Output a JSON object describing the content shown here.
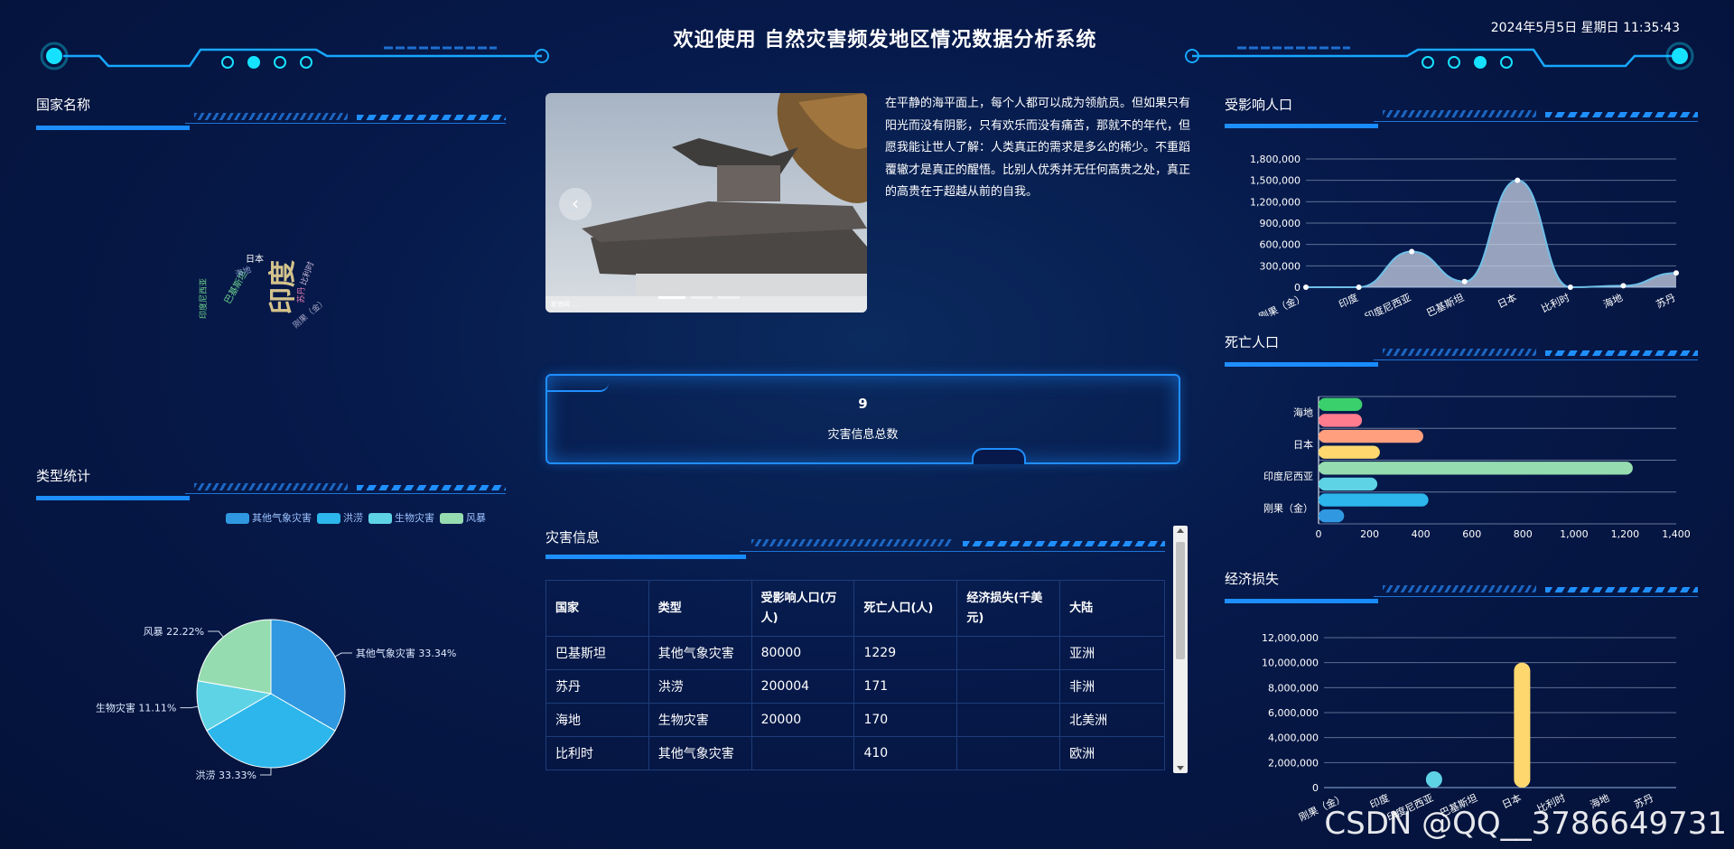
{
  "header": {
    "title": "欢迎使用 自然灾害频发地区情况数据分析系统",
    "datetime": "2024年5月5日 星期日 11:35:43"
  },
  "panels": {
    "country_names": "国家名称",
    "type_stats": "类型统计",
    "affected": "受影响人口",
    "deaths": "死亡人口",
    "economic": "经济损失",
    "disaster_info": "灾害信息"
  },
  "wordcloud": [
    {
      "text": "印度",
      "color": "#d4c38c"
    },
    {
      "text": "巴基斯坦",
      "color": "#6bd08c"
    },
    {
      "text": "日本",
      "color": "#ffffff"
    },
    {
      "text": "比利时",
      "color": "#c8b8d8"
    },
    {
      "text": "苏丹",
      "color": "#e47ab3"
    },
    {
      "text": "刚果（金）",
      "color": "#a6a6c8"
    },
    {
      "text": "印度尼西亚",
      "color": "#6bd08c"
    },
    {
      "text": "海地",
      "color": "#8aa2c8"
    }
  ],
  "intro_text": "在平静的海平面上，每个人都可以成为领航员。但如果只有阳光而没有阴影，只有欢乐而没有痛苦，那就不的年代，但愿我能让世人了解：人类真正的需求是多么的稀少。不重蹈覆辙才是真正的醒悟。比别人优秀并无任何高贵之处，真正的高贵在于超越从前的自我。",
  "carousel": {
    "prev_icon": "chevron-left-icon",
    "caption": "新浪网 ..."
  },
  "stat": {
    "value": "9",
    "label": "灾害信息总数"
  },
  "table": {
    "headers": [
      "国家",
      "类型",
      "受影响人口(万人)",
      "死亡人口(人)",
      "经济损失(千美元)",
      "大陆"
    ],
    "rows": [
      [
        "巴基斯坦",
        "其他气象灾害",
        "80000",
        "1229",
        "",
        "亚洲"
      ],
      [
        "苏丹",
        "洪涝",
        "200004",
        "171",
        "",
        "非洲"
      ],
      [
        "海地",
        "生物灾害",
        "20000",
        "170",
        "",
        "北美洲"
      ],
      [
        "比利时",
        "其他气象灾害",
        "",
        "410",
        "",
        "欧洲"
      ]
    ]
  },
  "colors": {
    "accent": "#1f8fff",
    "bg": "#06194a"
  },
  "chart_data": [
    {
      "type": "pie",
      "id": "type-stats",
      "legend": [
        "其他气象灾害",
        "洪涝",
        "生物灾害",
        "风暴"
      ],
      "slices": [
        {
          "name": "其他气象灾害",
          "value": 33.34,
          "label": "其他气象灾害 33.34%",
          "color": "#2f98e0"
        },
        {
          "name": "洪涝",
          "value": 33.33,
          "label": "洪涝 33.33%",
          "color": "#2cb6ec"
        },
        {
          "name": "生物灾害",
          "value": 11.11,
          "label": "生物灾害 11.11%",
          "color": "#5fd3e6"
        },
        {
          "name": "风暴",
          "value": 22.22,
          "label": "风暴 22.22%",
          "color": "#96dcb1"
        }
      ]
    },
    {
      "type": "area",
      "id": "affected",
      "categories": [
        "刚果（金）",
        "印度",
        "印度尼西亚",
        "巴基斯坦",
        "日本",
        "比利时",
        "海地",
        "苏丹"
      ],
      "values": [
        0,
        0,
        500000,
        80000,
        1500000,
        0,
        20000,
        200004
      ],
      "ylim": [
        0,
        1800000
      ],
      "yticks": [
        "1,800,000",
        "1,500,000",
        "1,200,000",
        "900,000",
        "600,000",
        "300,000",
        "0"
      ]
    },
    {
      "type": "bar",
      "id": "deaths",
      "orientation": "horizontal",
      "labeled_categories": [
        "海地",
        "日本",
        "印度尼西亚",
        "刚果（金）"
      ],
      "values": [
        100,
        430,
        230,
        1230,
        240,
        410,
        170,
        171
      ],
      "colors": [
        "#2f98e0",
        "#2cb6ec",
        "#5fd3e6",
        "#96dcb1",
        "#fed86e",
        "#ff9f7e",
        "#ff7b8e",
        "#3ad06c"
      ],
      "xlim": [
        0,
        1400
      ],
      "xticks": [
        "0",
        "200",
        "400",
        "600",
        "800",
        "1,000",
        "1,200",
        "1,400"
      ]
    },
    {
      "type": "bar",
      "id": "economic",
      "categories": [
        "刚果（金）",
        "印度",
        "印度尼西亚",
        "巴基斯坦",
        "日本",
        "比利时",
        "海地",
        "苏丹"
      ],
      "values": [
        0,
        0,
        300000,
        0,
        10000000,
        0,
        0,
        0
      ],
      "colors": [
        "#2f98e0",
        "#2cb6ec",
        "#5fd3e6",
        "#96dcb1",
        "#fed86e",
        "#ff9f7e",
        "#ff7b8e",
        "#3ad06c"
      ],
      "ylim": [
        0,
        12000000
      ],
      "yticks": [
        "12,000,000",
        "10,000,000",
        "8,000,000",
        "6,000,000",
        "4,000,000",
        "2,000,000",
        "0"
      ]
    }
  ],
  "watermark": "CSDN @QQ__3786649731"
}
